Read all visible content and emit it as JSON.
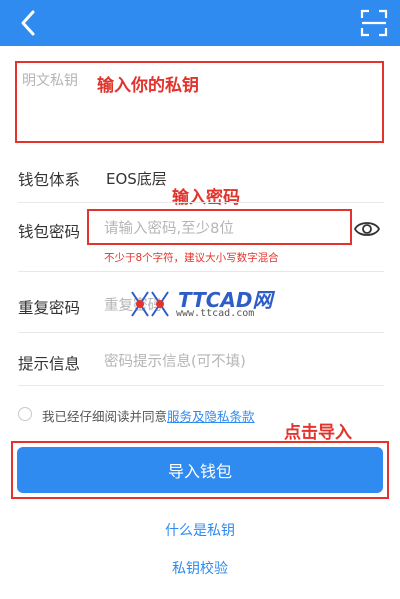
{
  "colors": {
    "brand": "#2f8bf0",
    "annotation": "#e2342c"
  },
  "header": {
    "back_icon": "chevron-left-icon",
    "scan_icon": "scan-frame-icon"
  },
  "private_key": {
    "placeholder": "明文私钥",
    "annotation": "输入你的私钥"
  },
  "wallet_system": {
    "label": "钱包体系",
    "value": "EOS底层",
    "annotation": "输入密码"
  },
  "wallet_password": {
    "label": "钱包密码",
    "placeholder": "请输入密码,至少8位",
    "hint": "不少于8个字符，建议大小写数字混合",
    "toggle_icon": "eye-icon"
  },
  "repeat_password": {
    "label": "重复密码",
    "placeholder": "重复密码"
  },
  "password_hint": {
    "label": "提示信息",
    "placeholder": "密码提示信息(可不填)"
  },
  "agreement": {
    "text": "我已经仔细阅读并同意",
    "link": "服务及隐私条款",
    "annotation": "点击导入"
  },
  "import_button": {
    "label": "导入钱包"
  },
  "links": {
    "what_is_key": "什么是私钥",
    "verify_key": "私钥校验"
  },
  "watermark": {
    "brand": "TTCAD网",
    "url": "www.ttcad.com"
  }
}
